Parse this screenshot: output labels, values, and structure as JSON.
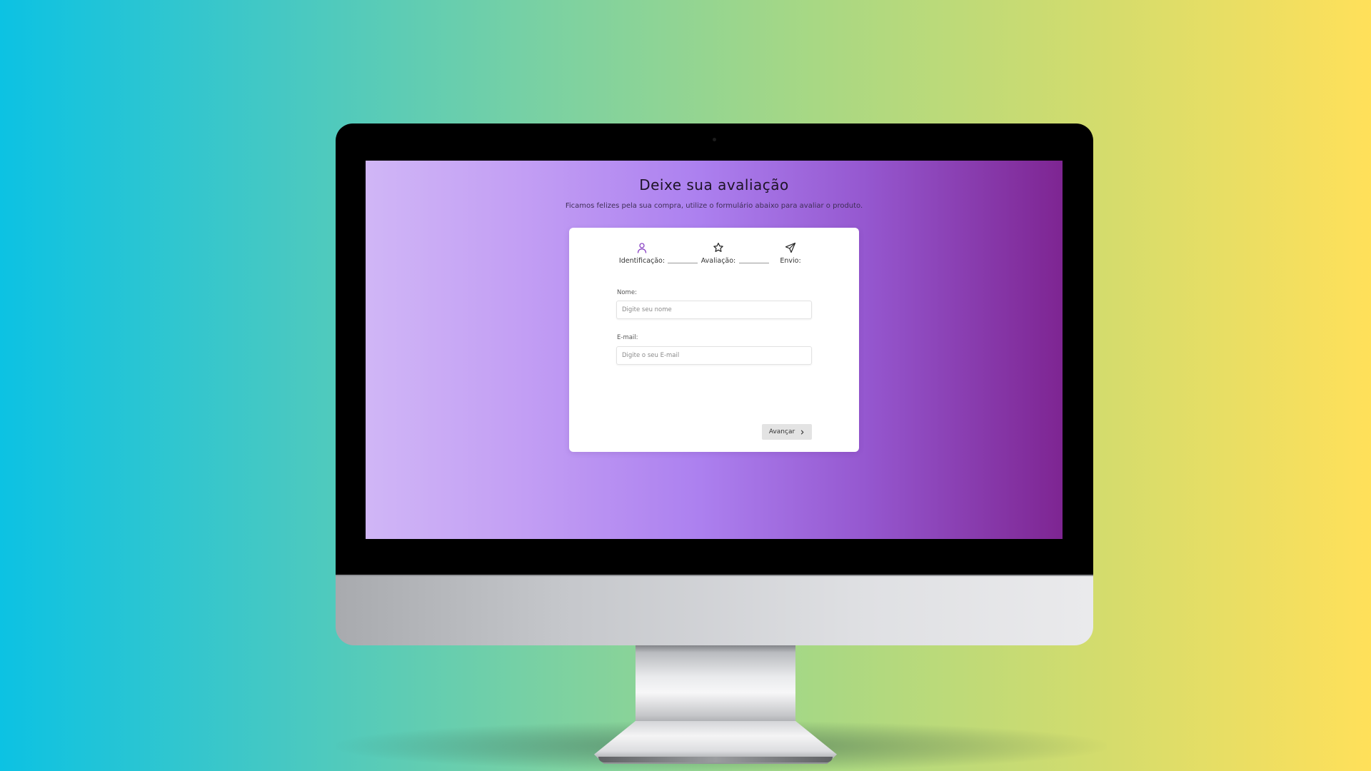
{
  "page": {
    "title": "Deixe sua avaliação",
    "subtitle": "Ficamos felizes pela sua compra, utilize o formulário abaixo para avaliar o produto."
  },
  "steps": [
    {
      "label": "Identificação:",
      "icon": "user-icon",
      "active": true
    },
    {
      "label": "Avaliação:",
      "icon": "star-icon",
      "active": false
    },
    {
      "label": "Envio:",
      "icon": "send-icon",
      "active": false
    }
  ],
  "form": {
    "name_label": "Nome:",
    "name_placeholder": "Digite seu nome",
    "email_label": "E-mail:",
    "email_placeholder": "Digite o seu E-mail",
    "next_label": "Avançar",
    "next_icon": "chevron-right-icon"
  },
  "colors": {
    "active_step": "#8a45c4",
    "screen_gradient": [
      "#d0b6f6",
      "#ac80ef",
      "#7e2592"
    ],
    "background_gradient": [
      "#0cc2e3",
      "#a9d883",
      "#ffe05a"
    ]
  }
}
